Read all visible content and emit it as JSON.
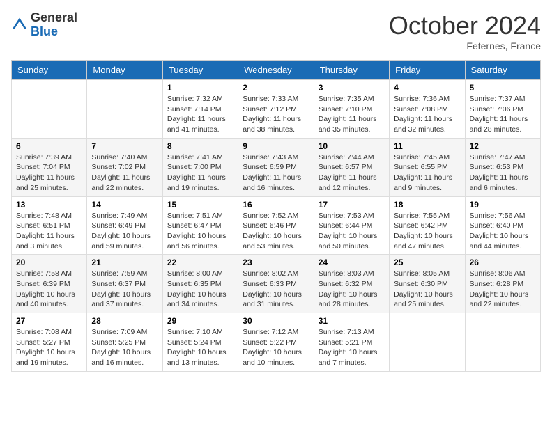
{
  "header": {
    "logo_general": "General",
    "logo_blue": "Blue",
    "month_title": "October 2024",
    "location": "Feternes, France"
  },
  "days_of_week": [
    "Sunday",
    "Monday",
    "Tuesday",
    "Wednesday",
    "Thursday",
    "Friday",
    "Saturday"
  ],
  "weeks": [
    [
      {
        "day": "",
        "sunrise": "",
        "sunset": "",
        "daylight": ""
      },
      {
        "day": "",
        "sunrise": "",
        "sunset": "",
        "daylight": ""
      },
      {
        "day": "1",
        "sunrise": "Sunrise: 7:32 AM",
        "sunset": "Sunset: 7:14 PM",
        "daylight": "Daylight: 11 hours and 41 minutes."
      },
      {
        "day": "2",
        "sunrise": "Sunrise: 7:33 AM",
        "sunset": "Sunset: 7:12 PM",
        "daylight": "Daylight: 11 hours and 38 minutes."
      },
      {
        "day": "3",
        "sunrise": "Sunrise: 7:35 AM",
        "sunset": "Sunset: 7:10 PM",
        "daylight": "Daylight: 11 hours and 35 minutes."
      },
      {
        "day": "4",
        "sunrise": "Sunrise: 7:36 AM",
        "sunset": "Sunset: 7:08 PM",
        "daylight": "Daylight: 11 hours and 32 minutes."
      },
      {
        "day": "5",
        "sunrise": "Sunrise: 7:37 AM",
        "sunset": "Sunset: 7:06 PM",
        "daylight": "Daylight: 11 hours and 28 minutes."
      }
    ],
    [
      {
        "day": "6",
        "sunrise": "Sunrise: 7:39 AM",
        "sunset": "Sunset: 7:04 PM",
        "daylight": "Daylight: 11 hours and 25 minutes."
      },
      {
        "day": "7",
        "sunrise": "Sunrise: 7:40 AM",
        "sunset": "Sunset: 7:02 PM",
        "daylight": "Daylight: 11 hours and 22 minutes."
      },
      {
        "day": "8",
        "sunrise": "Sunrise: 7:41 AM",
        "sunset": "Sunset: 7:00 PM",
        "daylight": "Daylight: 11 hours and 19 minutes."
      },
      {
        "day": "9",
        "sunrise": "Sunrise: 7:43 AM",
        "sunset": "Sunset: 6:59 PM",
        "daylight": "Daylight: 11 hours and 16 minutes."
      },
      {
        "day": "10",
        "sunrise": "Sunrise: 7:44 AM",
        "sunset": "Sunset: 6:57 PM",
        "daylight": "Daylight: 11 hours and 12 minutes."
      },
      {
        "day": "11",
        "sunrise": "Sunrise: 7:45 AM",
        "sunset": "Sunset: 6:55 PM",
        "daylight": "Daylight: 11 hours and 9 minutes."
      },
      {
        "day": "12",
        "sunrise": "Sunrise: 7:47 AM",
        "sunset": "Sunset: 6:53 PM",
        "daylight": "Daylight: 11 hours and 6 minutes."
      }
    ],
    [
      {
        "day": "13",
        "sunrise": "Sunrise: 7:48 AM",
        "sunset": "Sunset: 6:51 PM",
        "daylight": "Daylight: 11 hours and 3 minutes."
      },
      {
        "day": "14",
        "sunrise": "Sunrise: 7:49 AM",
        "sunset": "Sunset: 6:49 PM",
        "daylight": "Daylight: 10 hours and 59 minutes."
      },
      {
        "day": "15",
        "sunrise": "Sunrise: 7:51 AM",
        "sunset": "Sunset: 6:47 PM",
        "daylight": "Daylight: 10 hours and 56 minutes."
      },
      {
        "day": "16",
        "sunrise": "Sunrise: 7:52 AM",
        "sunset": "Sunset: 6:46 PM",
        "daylight": "Daylight: 10 hours and 53 minutes."
      },
      {
        "day": "17",
        "sunrise": "Sunrise: 7:53 AM",
        "sunset": "Sunset: 6:44 PM",
        "daylight": "Daylight: 10 hours and 50 minutes."
      },
      {
        "day": "18",
        "sunrise": "Sunrise: 7:55 AM",
        "sunset": "Sunset: 6:42 PM",
        "daylight": "Daylight: 10 hours and 47 minutes."
      },
      {
        "day": "19",
        "sunrise": "Sunrise: 7:56 AM",
        "sunset": "Sunset: 6:40 PM",
        "daylight": "Daylight: 10 hours and 44 minutes."
      }
    ],
    [
      {
        "day": "20",
        "sunrise": "Sunrise: 7:58 AM",
        "sunset": "Sunset: 6:39 PM",
        "daylight": "Daylight: 10 hours and 40 minutes."
      },
      {
        "day": "21",
        "sunrise": "Sunrise: 7:59 AM",
        "sunset": "Sunset: 6:37 PM",
        "daylight": "Daylight: 10 hours and 37 minutes."
      },
      {
        "day": "22",
        "sunrise": "Sunrise: 8:00 AM",
        "sunset": "Sunset: 6:35 PM",
        "daylight": "Daylight: 10 hours and 34 minutes."
      },
      {
        "day": "23",
        "sunrise": "Sunrise: 8:02 AM",
        "sunset": "Sunset: 6:33 PM",
        "daylight": "Daylight: 10 hours and 31 minutes."
      },
      {
        "day": "24",
        "sunrise": "Sunrise: 8:03 AM",
        "sunset": "Sunset: 6:32 PM",
        "daylight": "Daylight: 10 hours and 28 minutes."
      },
      {
        "day": "25",
        "sunrise": "Sunrise: 8:05 AM",
        "sunset": "Sunset: 6:30 PM",
        "daylight": "Daylight: 10 hours and 25 minutes."
      },
      {
        "day": "26",
        "sunrise": "Sunrise: 8:06 AM",
        "sunset": "Sunset: 6:28 PM",
        "daylight": "Daylight: 10 hours and 22 minutes."
      }
    ],
    [
      {
        "day": "27",
        "sunrise": "Sunrise: 7:08 AM",
        "sunset": "Sunset: 5:27 PM",
        "daylight": "Daylight: 10 hours and 19 minutes."
      },
      {
        "day": "28",
        "sunrise": "Sunrise: 7:09 AM",
        "sunset": "Sunset: 5:25 PM",
        "daylight": "Daylight: 10 hours and 16 minutes."
      },
      {
        "day": "29",
        "sunrise": "Sunrise: 7:10 AM",
        "sunset": "Sunset: 5:24 PM",
        "daylight": "Daylight: 10 hours and 13 minutes."
      },
      {
        "day": "30",
        "sunrise": "Sunrise: 7:12 AM",
        "sunset": "Sunset: 5:22 PM",
        "daylight": "Daylight: 10 hours and 10 minutes."
      },
      {
        "day": "31",
        "sunrise": "Sunrise: 7:13 AM",
        "sunset": "Sunset: 5:21 PM",
        "daylight": "Daylight: 10 hours and 7 minutes."
      },
      {
        "day": "",
        "sunrise": "",
        "sunset": "",
        "daylight": ""
      },
      {
        "day": "",
        "sunrise": "",
        "sunset": "",
        "daylight": ""
      }
    ]
  ]
}
